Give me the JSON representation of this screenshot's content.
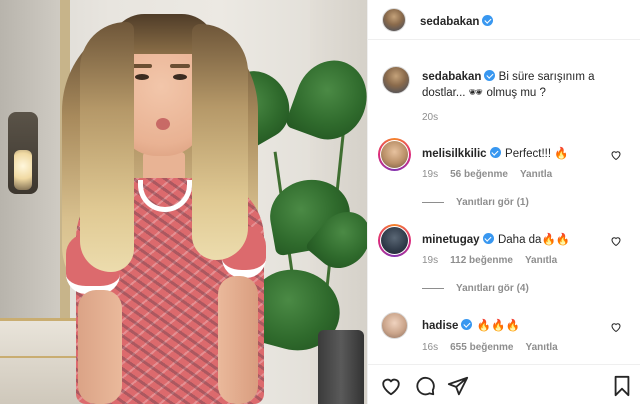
{
  "post": {
    "author": "sedabakan",
    "caption_text": "Bi süre sarışınım a dostlar... 🕶 olmuş mu ?",
    "caption_time": "20s"
  },
  "comments": [
    {
      "username": "melisilkkilic",
      "text": "Perfect!!! 🔥",
      "time": "19s",
      "likes": "56 beğenme",
      "reply": "Yanıtla",
      "view_replies": "Yanıtları gör (1)"
    },
    {
      "username": "minetugay",
      "text": "Daha da🔥🔥",
      "time": "19s",
      "likes": "112 beğenme",
      "reply": "Yanıtla",
      "view_replies": "Yanıtları gör (4)"
    },
    {
      "username": "hadise",
      "text": "🔥🔥🔥",
      "time": "16s",
      "likes": "655 beğenme",
      "reply": "Yanıtla"
    }
  ],
  "colors": {
    "verified": "#3897f0",
    "text": "#262626",
    "muted": "#8e8e8e",
    "border": "#efefef"
  },
  "icons": [
    "heart-icon",
    "comment-icon",
    "share-icon",
    "bookmark-icon",
    "verified-badge-icon"
  ]
}
